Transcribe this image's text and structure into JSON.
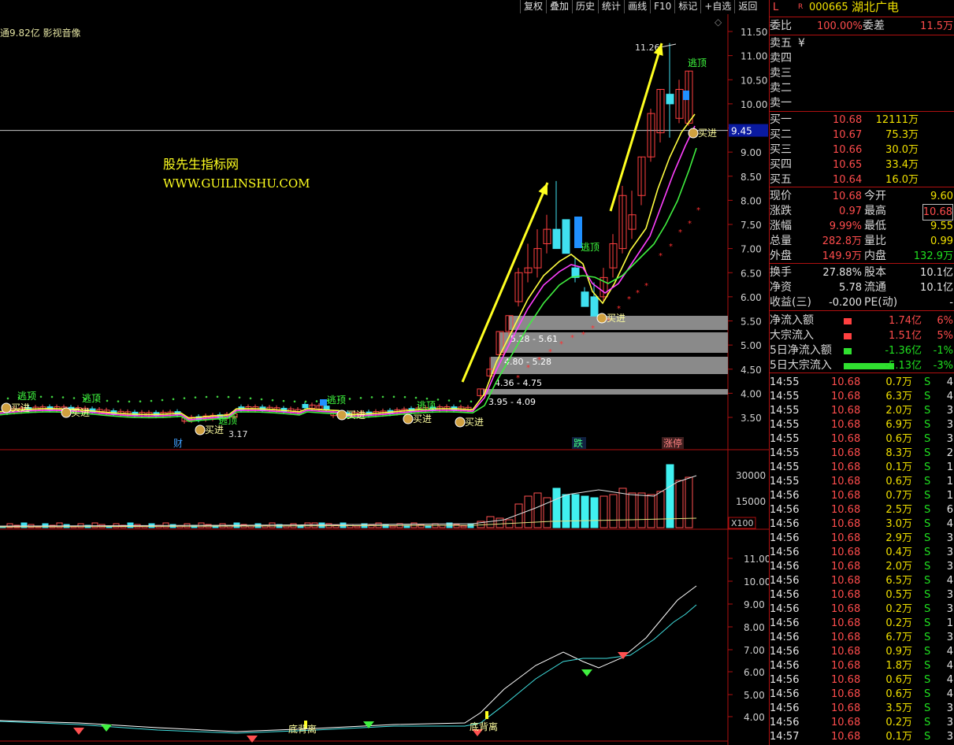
{
  "toolbar": [
    "复权",
    "叠加",
    "历史",
    "统计",
    "画线",
    "F10",
    "标记",
    "+自选",
    "返回"
  ],
  "chart_header": "通9.82亿 影视音像",
  "watermark": {
    "line1": "股先生指标网",
    "line2": "WWW.GUILINSHU.COM"
  },
  "price_axis": [
    "11.50",
    "11.00",
    "10.50",
    "10.00",
    "9.50",
    "9.00",
    "8.50",
    "8.00",
    "7.50",
    "7.00",
    "6.50",
    "6.00",
    "5.50",
    "5.00",
    "4.50",
    "4.00",
    "3.50"
  ],
  "current_price_tag": "9.45",
  "high_label": "11.26",
  "low_label": "3.17",
  "ranges": [
    "5.28 - 5.61",
    "4.80 - 5.28",
    "4.36 - 4.75",
    "3.95 - 4.09"
  ],
  "signals": {
    "escape": "逃顶",
    "buy": "买进"
  },
  "event_markers": [
    "财",
    "跌",
    "涨停"
  ],
  "volume_axis": [
    "30000",
    "15000"
  ],
  "volume_unit": "X100",
  "indicator_axis": [
    "11.00",
    "10.00",
    "9.00",
    "8.00",
    "7.00",
    "6.00",
    "5.00",
    "4.00"
  ],
  "indicator_labels": [
    "底背离",
    "底背离"
  ],
  "quote": {
    "flag": "L",
    "r": "R",
    "code": "000665",
    "name": "湖北广电",
    "wei_bi_label": "委比",
    "wei_bi": "100.00%",
    "wei_cha_label": "委差",
    "wei_cha": "11.5万",
    "sell": [
      {
        "label": "卖五",
        "price": "",
        "vol": "",
        "extra": "¥"
      },
      {
        "label": "卖四",
        "price": "",
        "vol": ""
      },
      {
        "label": "卖三",
        "price": "",
        "vol": ""
      },
      {
        "label": "卖二",
        "price": "",
        "vol": ""
      },
      {
        "label": "卖一",
        "price": "",
        "vol": ""
      }
    ],
    "buy": [
      {
        "label": "买一",
        "price": "10.68",
        "vol": "12111万"
      },
      {
        "label": "买二",
        "price": "10.67",
        "vol": "75.3万"
      },
      {
        "label": "买三",
        "price": "10.66",
        "vol": "30.0万"
      },
      {
        "label": "买四",
        "price": "10.65",
        "vol": "33.4万"
      },
      {
        "label": "买五",
        "price": "10.64",
        "vol": "16.0万"
      }
    ],
    "stats": [
      {
        "l1": "现价",
        "v1": "10.68",
        "l2": "今开",
        "v2": "9.60"
      },
      {
        "l1": "涨跌",
        "v1": "0.97",
        "l2": "最高",
        "v2": "10.68"
      },
      {
        "l1": "涨幅",
        "v1": "9.99%",
        "l2": "最低",
        "v2": "9.55"
      },
      {
        "l1": "总量",
        "v1": "282.8万",
        "l2": "量比",
        "v2": "0.99"
      },
      {
        "l1": "外盘",
        "v1": "149.9万",
        "l2": "内盘",
        "v2": "132.9万"
      }
    ],
    "stats2": [
      {
        "l1": "换手",
        "v1": "27.88%",
        "l2": "股本",
        "v2": "10.1亿"
      },
      {
        "l1": "净资",
        "v1": "5.78",
        "l2": "流通",
        "v2": "10.1亿"
      },
      {
        "l1": "收益(三)",
        "v1": "-0.200",
        "l2": "PE(动)",
        "v2": "-"
      }
    ],
    "flows": [
      {
        "label": "净流入额",
        "value": "1.74亿",
        "pct": "6%",
        "bar": "red"
      },
      {
        "label": "大宗流入",
        "value": "1.51亿",
        "pct": "5%",
        "bar": "red"
      },
      {
        "label": "5日净流入额",
        "value": "-1.36亿",
        "pct": "-1%",
        "bar": "green"
      },
      {
        "label": "5日大宗流入",
        "value": "-5.13亿",
        "pct": "-3%",
        "bar": "green"
      }
    ],
    "ticks": [
      {
        "t": "14:55",
        "p": "10.68",
        "v": "0.7万",
        "s": "S",
        "n": "4"
      },
      {
        "t": "14:55",
        "p": "10.68",
        "v": "6.3万",
        "s": "S",
        "n": "4"
      },
      {
        "t": "14:55",
        "p": "10.68",
        "v": "2.0万",
        "s": "S",
        "n": "3"
      },
      {
        "t": "14:55",
        "p": "10.68",
        "v": "6.9万",
        "s": "S",
        "n": "3"
      },
      {
        "t": "14:55",
        "p": "10.68",
        "v": "0.6万",
        "s": "S",
        "n": "3"
      },
      {
        "t": "14:55",
        "p": "10.68",
        "v": "8.3万",
        "s": "S",
        "n": "2"
      },
      {
        "t": "14:55",
        "p": "10.68",
        "v": "0.1万",
        "s": "S",
        "n": "1"
      },
      {
        "t": "14:55",
        "p": "10.68",
        "v": "0.6万",
        "s": "S",
        "n": "1"
      },
      {
        "t": "14:56",
        "p": "10.68",
        "v": "0.7万",
        "s": "S",
        "n": "1"
      },
      {
        "t": "14:56",
        "p": "10.68",
        "v": "2.5万",
        "s": "S",
        "n": "6"
      },
      {
        "t": "14:56",
        "p": "10.68",
        "v": "3.0万",
        "s": "S",
        "n": "4"
      },
      {
        "t": "14:56",
        "p": "10.68",
        "v": "2.9万",
        "s": "S",
        "n": "3"
      },
      {
        "t": "14:56",
        "p": "10.68",
        "v": "0.4万",
        "s": "S",
        "n": "3"
      },
      {
        "t": "14:56",
        "p": "10.68",
        "v": "2.0万",
        "s": "S",
        "n": "3"
      },
      {
        "t": "14:56",
        "p": "10.68",
        "v": "6.5万",
        "s": "S",
        "n": "4"
      },
      {
        "t": "14:56",
        "p": "10.68",
        "v": "0.5万",
        "s": "S",
        "n": "3"
      },
      {
        "t": "14:56",
        "p": "10.68",
        "v": "0.2万",
        "s": "S",
        "n": "3"
      },
      {
        "t": "14:56",
        "p": "10.68",
        "v": "0.2万",
        "s": "S",
        "n": "1"
      },
      {
        "t": "14:56",
        "p": "10.68",
        "v": "6.7万",
        "s": "S",
        "n": "3"
      },
      {
        "t": "14:56",
        "p": "10.68",
        "v": "0.9万",
        "s": "S",
        "n": "4"
      },
      {
        "t": "14:56",
        "p": "10.68",
        "v": "1.8万",
        "s": "S",
        "n": "4"
      },
      {
        "t": "14:56",
        "p": "10.68",
        "v": "0.6万",
        "s": "S",
        "n": "4"
      },
      {
        "t": "14:56",
        "p": "10.68",
        "v": "0.6万",
        "s": "S",
        "n": "4"
      },
      {
        "t": "14:56",
        "p": "10.68",
        "v": "3.5万",
        "s": "S",
        "n": "3"
      },
      {
        "t": "14:56",
        "p": "10.68",
        "v": "0.2万",
        "s": "S",
        "n": "3"
      },
      {
        "t": "14:57",
        "p": "10.68",
        "v": "0.1万",
        "s": "S",
        "n": "3"
      }
    ]
  },
  "chart_data": {
    "type": "table",
    "candles_recent_daily_ohlc": [
      [
        3.95,
        4.09,
        3.9,
        4.09
      ],
      [
        4.36,
        4.75,
        4.3,
        4.5
      ],
      [
        4.8,
        5.28,
        4.75,
        5.28
      ],
      [
        5.28,
        5.61,
        5.2,
        5.61
      ],
      [
        5.9,
        6.6,
        5.8,
        6.5
      ],
      [
        6.5,
        7.1,
        6.3,
        6.6
      ],
      [
        6.6,
        7.4,
        6.4,
        7.0
      ],
      [
        7.1,
        7.7,
        6.9,
        7.4
      ],
      [
        7.4,
        8.4,
        7.2,
        7.0
      ],
      [
        7.6,
        7.6,
        6.9,
        6.9
      ],
      [
        6.6,
        6.8,
        6.3,
        6.4
      ],
      [
        6.1,
        6.2,
        5.8,
        5.8
      ],
      [
        6.0,
        6.3,
        5.6,
        5.6
      ],
      [
        6.0,
        6.6,
        5.9,
        6.4
      ],
      [
        6.6,
        7.3,
        6.4,
        7.1
      ],
      [
        7.0,
        8.3,
        6.9,
        8.1
      ],
      [
        7.4,
        8.2,
        7.2,
        7.7
      ],
      [
        8.1,
        8.9,
        7.9,
        8.9
      ],
      [
        8.9,
        9.9,
        8.8,
        9.8
      ],
      [
        9.4,
        10.3,
        9.2,
        10.3
      ],
      [
        10.2,
        11.26,
        9.3,
        10.0
      ],
      [
        9.7,
        10.5,
        9.6,
        10.3
      ],
      [
        9.6,
        10.68,
        9.55,
        10.68
      ]
    ],
    "ylim": [
      3.2,
      11.7
    ]
  }
}
